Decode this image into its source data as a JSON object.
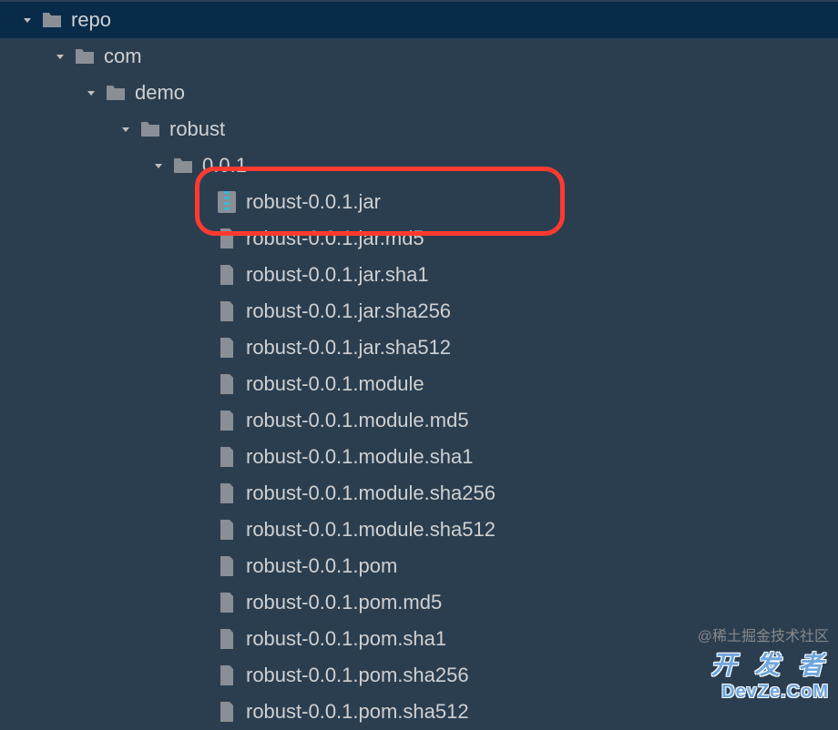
{
  "tree": {
    "root": {
      "label": "repo",
      "type": "folder",
      "expanded": true
    },
    "level1": {
      "label": "com",
      "type": "folder",
      "expanded": true
    },
    "level2": {
      "label": "demo",
      "type": "folder",
      "expanded": true
    },
    "level3": {
      "label": "robust",
      "type": "folder",
      "expanded": true
    },
    "level4": {
      "label": "0.0.1",
      "type": "folder",
      "expanded": true
    },
    "files": [
      {
        "label": "robust-0.0.1.jar",
        "type": "archive",
        "highlighted": true
      },
      {
        "label": "robust-0.0.1.jar.md5",
        "type": "file"
      },
      {
        "label": "robust-0.0.1.jar.sha1",
        "type": "file"
      },
      {
        "label": "robust-0.0.1.jar.sha256",
        "type": "file"
      },
      {
        "label": "robust-0.0.1.jar.sha512",
        "type": "file"
      },
      {
        "label": "robust-0.0.1.module",
        "type": "file"
      },
      {
        "label": "robust-0.0.1.module.md5",
        "type": "file"
      },
      {
        "label": "robust-0.0.1.module.sha1",
        "type": "file"
      },
      {
        "label": "robust-0.0.1.module.sha256",
        "type": "file"
      },
      {
        "label": "robust-0.0.1.module.sha512",
        "type": "file"
      },
      {
        "label": "robust-0.0.1.pom",
        "type": "file"
      },
      {
        "label": "robust-0.0.1.pom.md5",
        "type": "file"
      },
      {
        "label": "robust-0.0.1.pom.sha1",
        "type": "file"
      },
      {
        "label": "robust-0.0.1.pom.sha256",
        "type": "file"
      },
      {
        "label": "robust-0.0.1.pom.sha512",
        "type": "file"
      }
    ]
  },
  "watermark": {
    "line0": "@稀土掘金技术社区",
    "line1": "开 发 者",
    "line2": "DevZe.CoM"
  }
}
